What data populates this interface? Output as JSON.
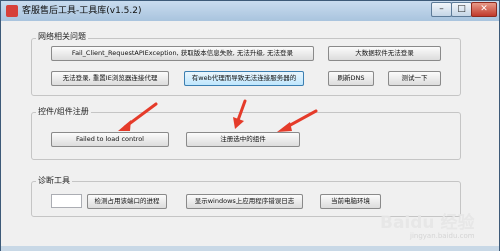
{
  "window": {
    "title": "客服售后工具-工具库(v1.5.2)",
    "controls": {
      "minimize": "–",
      "maximize": "□",
      "close": "✕"
    }
  },
  "groups": {
    "network": {
      "label": "网络相关问题",
      "buttons": [
        "Fail_Client_RequestAPIException, 获取版本信息失败, 无法升级, 无法登录",
        "大数据软件无法登录",
        "无法登录, 重置IE浏览器连接代理",
        "有web代理而导致无法连接服务器的",
        "刷新DNS",
        "测试一下"
      ]
    },
    "controls": {
      "label": "控件/组件注册",
      "buttons": [
        "Failed to load control",
        "注册选中的组件"
      ]
    },
    "diagnostics": {
      "label": "诊断工具",
      "input_value": "",
      "buttons": [
        "检测占用该端口的进程",
        "显示windows上应用程序错误日志",
        "当前电脑环境"
      ]
    }
  },
  "watermark": {
    "brand": "Baidu 经验",
    "url": "jingyan.baidu.com"
  },
  "colors": {
    "arrow": "#e53b2a",
    "titlebar": "#b7cfe6",
    "close": "#c0392b"
  }
}
